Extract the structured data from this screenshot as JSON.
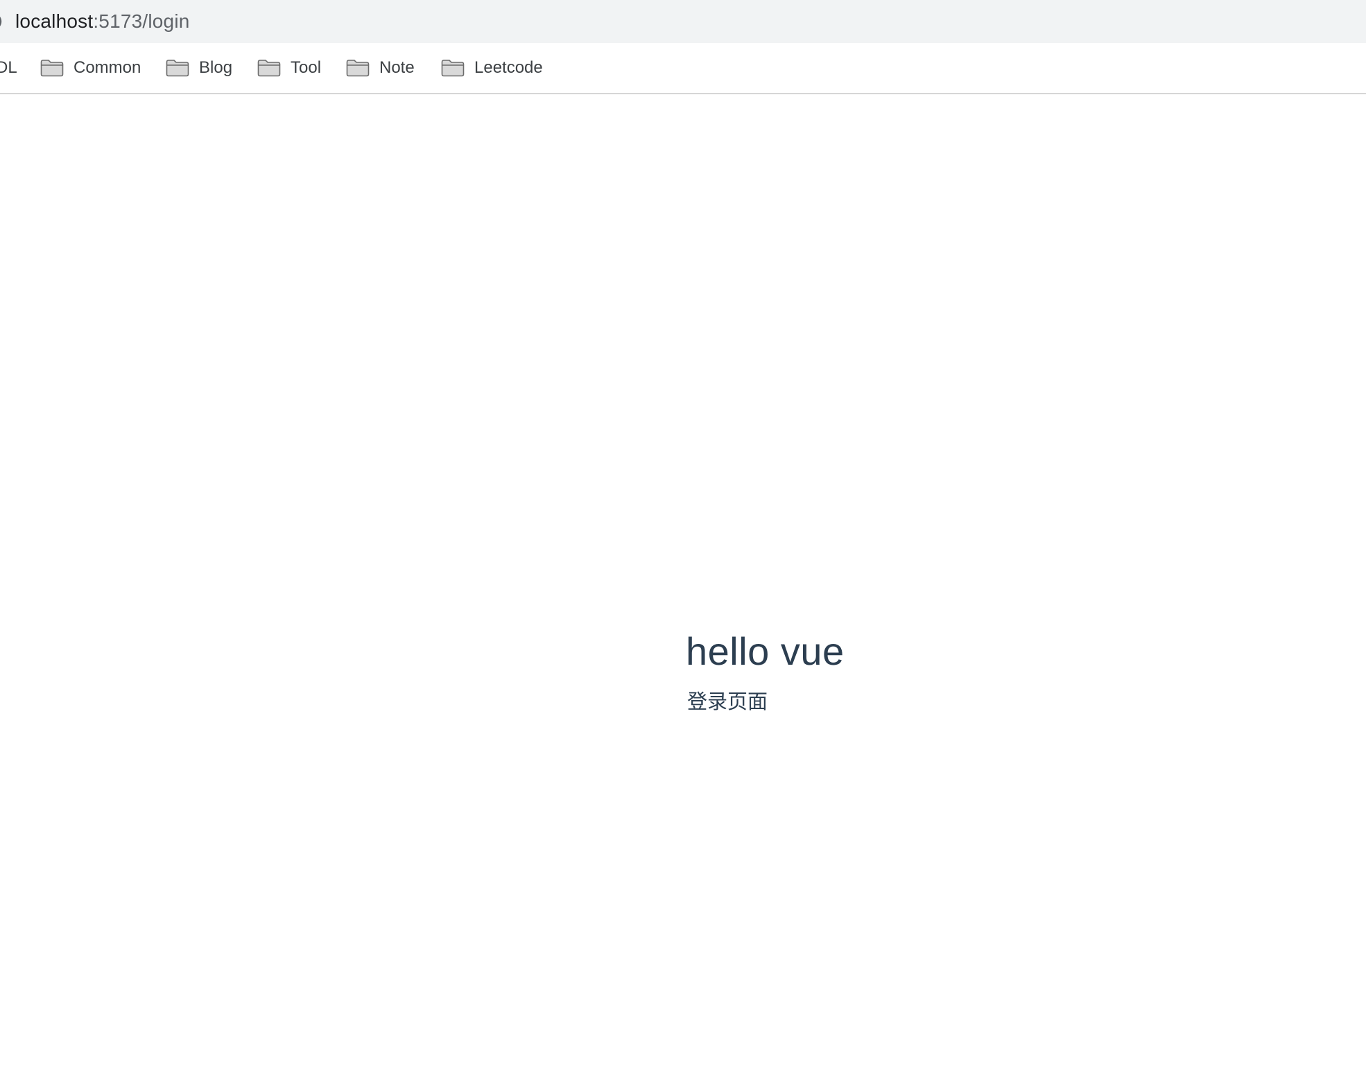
{
  "browser": {
    "address_bar": {
      "icon": "info-icon",
      "url_host": "localhost",
      "url_rest": ":5173/login"
    },
    "bookmarks": {
      "partial_item_label": "DL",
      "items": [
        {
          "label": "Common",
          "icon": "folder-icon"
        },
        {
          "label": "Blog",
          "icon": "folder-icon"
        },
        {
          "label": "Tool",
          "icon": "folder-icon"
        },
        {
          "label": "Note",
          "icon": "folder-icon"
        },
        {
          "label": "Leetcode",
          "icon": "folder-icon"
        }
      ]
    }
  },
  "page": {
    "title": "hello vue",
    "subtitle": "登录页面"
  },
  "colors": {
    "address_bar_bg": "#f1f3f4",
    "text_primary": "#2c3e50",
    "bookmark_text": "#3c4043",
    "url_host": "#202124",
    "url_rest": "#5f6368",
    "divider": "#d6d6d6"
  }
}
